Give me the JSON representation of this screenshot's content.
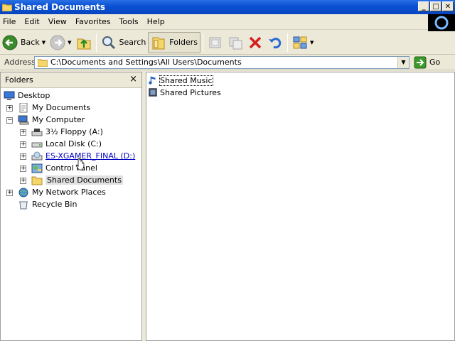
{
  "window": {
    "title": "Shared Documents",
    "min_glyph": "_",
    "max_glyph": "□",
    "close_glyph": "✕"
  },
  "menu": [
    "File",
    "Edit",
    "View",
    "Favorites",
    "Tools",
    "Help"
  ],
  "toolbar": {
    "back_label": "Back",
    "search_label": "Search",
    "folders_label": "Folders"
  },
  "address": {
    "label": "Address",
    "value": "C:\\Documents and Settings\\All Users\\Documents",
    "go_label": "Go"
  },
  "folders_pane": {
    "title": "Folders",
    "close_glyph": "×",
    "tree": [
      {
        "label": "Desktop",
        "icon": "desktop-icon",
        "expander": ""
      },
      {
        "label": "My Documents",
        "icon": "my-documents-icon",
        "expander": "+"
      },
      {
        "label": "My Computer",
        "icon": "my-computer-icon",
        "expander": "−"
      },
      {
        "label": "3½ Floppy (A:)",
        "icon": "floppy-drive-icon",
        "expander": "+"
      },
      {
        "label": "Local Disk (C:)",
        "icon": "hard-disk-icon",
        "expander": "+"
      },
      {
        "label": "ES-XGAMER_FINAL (D:)",
        "icon": "cd-drive-icon",
        "expander": "+"
      },
      {
        "label": "Control Panel",
        "icon": "control-panel-icon",
        "expander": "+"
      },
      {
        "label": "Shared Documents",
        "icon": "folder-icon",
        "expander": "+"
      },
      {
        "label": "My Network Places",
        "icon": "network-places-icon",
        "expander": "+"
      },
      {
        "label": "Recycle Bin",
        "icon": "recycle-bin-icon",
        "expander": ""
      }
    ]
  },
  "content": {
    "items": [
      {
        "label": "Shared Music",
        "icon": "music-folder-icon"
      },
      {
        "label": "Shared Pictures",
        "icon": "pictures-folder-icon"
      }
    ]
  },
  "colors": {
    "titlebar": "#0a52d4",
    "selection": "#e0e0e0",
    "link_hover": "#0000c0"
  }
}
